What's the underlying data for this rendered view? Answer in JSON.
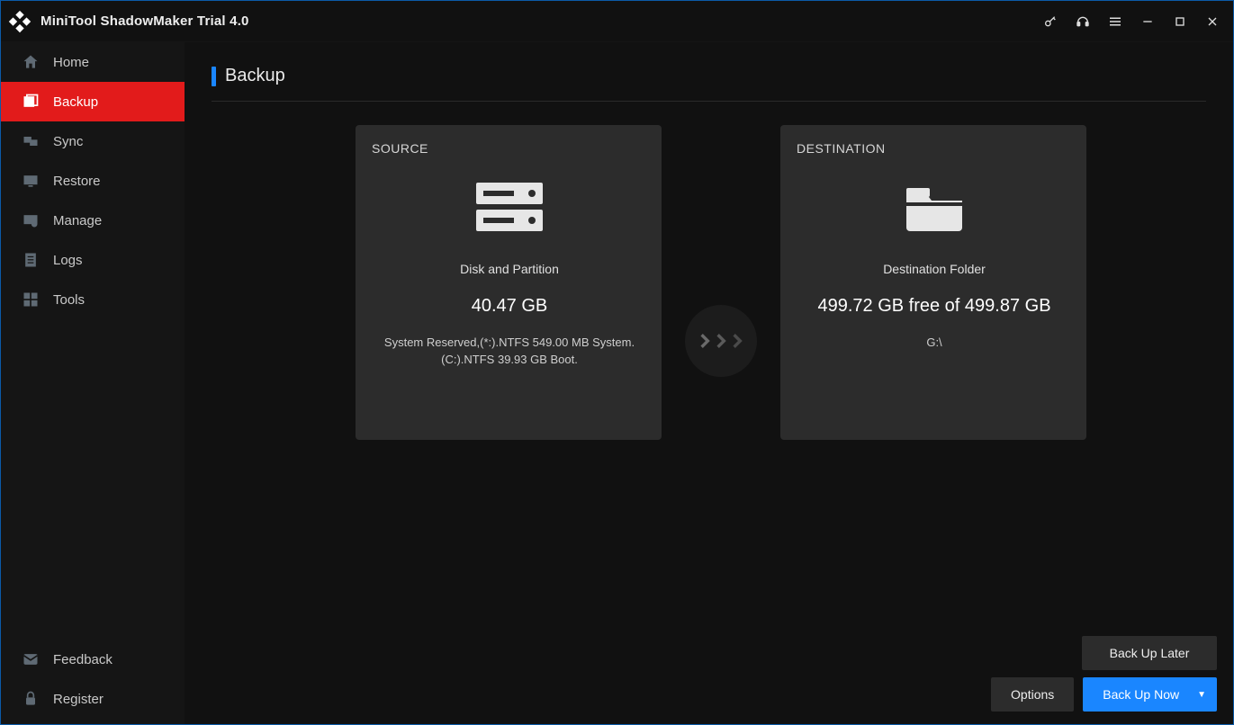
{
  "app": {
    "title": "MiniTool ShadowMaker Trial 4.0"
  },
  "sidebar": {
    "items": [
      {
        "label": "Home",
        "icon": "home-icon"
      },
      {
        "label": "Backup",
        "icon": "backup-icon",
        "active": true
      },
      {
        "label": "Sync",
        "icon": "sync-icon"
      },
      {
        "label": "Restore",
        "icon": "restore-icon"
      },
      {
        "label": "Manage",
        "icon": "manage-icon"
      },
      {
        "label": "Logs",
        "icon": "logs-icon"
      },
      {
        "label": "Tools",
        "icon": "tools-icon"
      }
    ],
    "bottom": [
      {
        "label": "Feedback",
        "icon": "feedback-icon"
      },
      {
        "label": "Register",
        "icon": "register-icon"
      }
    ]
  },
  "page": {
    "title": "Backup"
  },
  "source": {
    "heading": "SOURCE",
    "type": "Disk and Partition",
    "size": "40.47 GB",
    "details": "System Reserved,(*:).NTFS 549.00 MB System.(C:).NTFS 39.93 GB Boot."
  },
  "destination": {
    "heading": "DESTINATION",
    "type": "Destination Folder",
    "free_text": "499.72 GB free of 499.87 GB",
    "path": "G:\\"
  },
  "buttons": {
    "back_up_later": "Back Up Later",
    "options": "Options",
    "back_up_now": "Back Up Now"
  }
}
